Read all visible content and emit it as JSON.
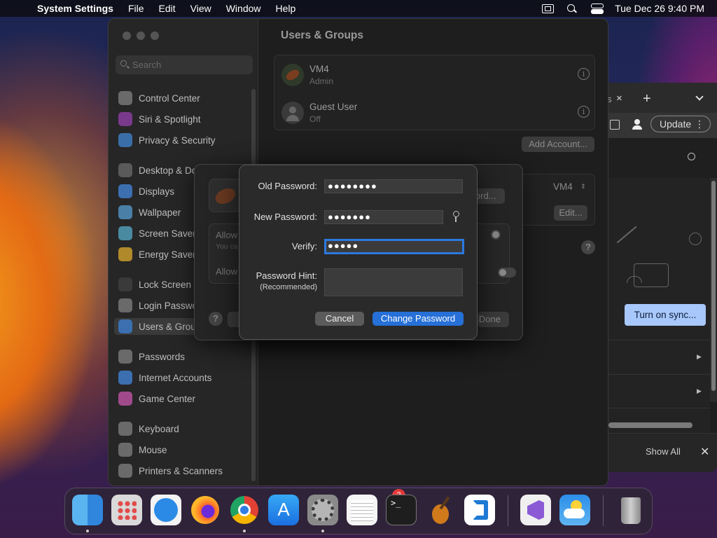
{
  "menubar": {
    "app": "System Settings",
    "items": [
      "File",
      "Edit",
      "View",
      "Window",
      "Help"
    ],
    "clock": "Tue Dec 26  9:40 PM"
  },
  "sidebar": {
    "search_placeholder": "Search",
    "items": [
      {
        "label": "Control Center",
        "icon": "control-center-icon",
        "color": "#6a6a6a"
      },
      {
        "label": "Siri & Spotlight",
        "icon": "siri-icon",
        "color": "#7a3a8c"
      },
      {
        "label": "Privacy & Security",
        "icon": "hand-icon",
        "color": "#3a6ea8"
      },
      {
        "label": "Desktop & Dock",
        "icon": "dock-icon",
        "color": "#5a5a5a"
      },
      {
        "label": "Displays",
        "icon": "displays-icon",
        "color": "#3b6fb0"
      },
      {
        "label": "Wallpaper",
        "icon": "wallpaper-icon",
        "color": "#4a7fa8"
      },
      {
        "label": "Screen Saver",
        "icon": "screensaver-icon",
        "color": "#4a8aa0"
      },
      {
        "label": "Energy Saver",
        "icon": "energy-icon",
        "color": "#b08a2a"
      },
      {
        "label": "Lock Screen",
        "icon": "lock-icon",
        "color": "#3a3a3a"
      },
      {
        "label": "Login Password",
        "icon": "login-password-icon",
        "color": "#6a6a6a"
      },
      {
        "label": "Users & Groups",
        "icon": "users-icon",
        "color": "#3b6fb0"
      },
      {
        "label": "Passwords",
        "icon": "key-icon",
        "color": "#6a6a6a"
      },
      {
        "label": "Internet Accounts",
        "icon": "at-icon",
        "color": "#3b6fb0"
      },
      {
        "label": "Game Center",
        "icon": "game-center-icon",
        "color": "#a04a8a"
      },
      {
        "label": "Keyboard",
        "icon": "keyboard-icon",
        "color": "#6a6a6a"
      },
      {
        "label": "Mouse",
        "icon": "mouse-icon",
        "color": "#6a6a6a"
      },
      {
        "label": "Printers & Scanners",
        "icon": "printer-icon",
        "color": "#6a6a6a"
      }
    ]
  },
  "content": {
    "title": "Users & Groups",
    "users": [
      {
        "name": "VM4",
        "role": "Admin"
      },
      {
        "name": "Guest User",
        "role": "Off"
      }
    ],
    "add_account": "Add Account...",
    "auto_login_value": "VM4",
    "edit_label": "Edit..."
  },
  "sheet": {
    "allow_1": "Allow",
    "allow_1_sub": "You ca",
    "allow_2": "Allow",
    "password_btn": "ord...",
    "done": "Done"
  },
  "dialog": {
    "old_label": "Old Password:",
    "old_value": "●●●●●●●●",
    "new_label": "New Password:",
    "new_value": "●●●●●●●",
    "verify_label": "Verify:",
    "verify_value": "●●●●●",
    "hint_label": "Password Hint:",
    "hint_sub": "(Recommended)",
    "hint_value": "",
    "cancel": "Cancel",
    "change": "Change Password"
  },
  "browser": {
    "tab_close": "×",
    "new_tab": "+",
    "update": "Update",
    "sync": "Turn on sync...",
    "show_all": "Show All",
    "close": "✕"
  },
  "dock": {
    "apps": [
      "Finder",
      "Launchpad",
      "Safari",
      "Firefox",
      "Chrome",
      "App Store",
      "System Settings",
      "TextEdit",
      "Terminal",
      "GarageBand",
      "VS Code",
      "Visual Studio",
      "Weather",
      "Trash"
    ],
    "settings_badge": "2"
  }
}
